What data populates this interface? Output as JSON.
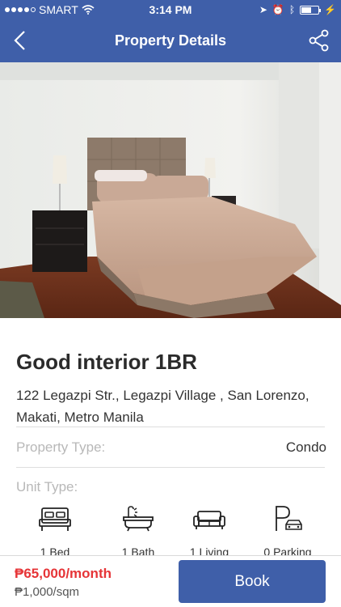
{
  "status_bar": {
    "carrier": "SMART",
    "time": "3:14 PM"
  },
  "nav": {
    "title": "Property Details",
    "back_icon": "chevron-left-icon",
    "share_icon": "share-icon"
  },
  "property": {
    "title": "Good interior 1BR",
    "address": "122 Legazpi Str., Legazpi Village , San Lorenzo, Makati, Metro Manila",
    "property_type_label": "Property Type:",
    "property_type_value": "Condo",
    "unit_type_label": "Unit Type:",
    "unit_features": [
      {
        "icon": "bed-icon",
        "label": "1 Bed"
      },
      {
        "icon": "bath-icon",
        "label": "1 Bath"
      },
      {
        "icon": "sofa-icon",
        "label": "1 Living"
      },
      {
        "icon": "parking-icon",
        "label": "0 Parking"
      }
    ]
  },
  "booking": {
    "price": "₱65,000/month",
    "price_per_sqm": "₱1,000/sqm",
    "book_label": "Book"
  },
  "colors": {
    "brand": "#3f5fa9",
    "price": "#e63437"
  }
}
